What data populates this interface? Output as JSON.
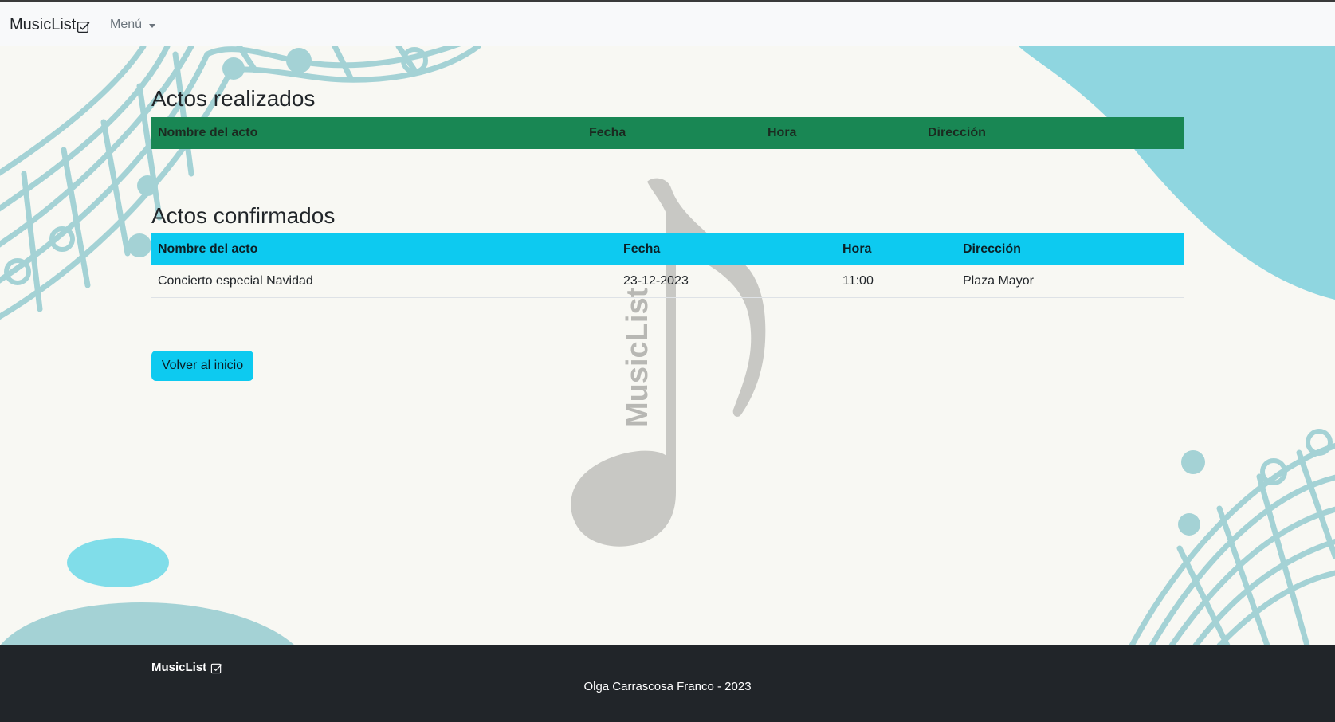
{
  "navbar": {
    "brand": "MusicList",
    "brand_icon": "check-square-icon",
    "menu_label": "Menú"
  },
  "watermark": {
    "text": "MusicList"
  },
  "sections": {
    "realizados": {
      "title": "Actos realizados",
      "columns": [
        "Nombre del acto",
        "Fecha",
        "Hora",
        "Dirección"
      ],
      "rows": []
    },
    "confirmados": {
      "title": "Actos confirmados",
      "columns": [
        "Nombre del acto",
        "Fecha",
        "Hora",
        "Dirección"
      ],
      "rows": [
        [
          "Concierto especial Navidad",
          "23-12-2023",
          "11:00",
          "Plaza Mayor"
        ]
      ]
    }
  },
  "buttons": {
    "home": "Volver al inicio"
  },
  "footer": {
    "brand": "MusicList",
    "brand_icon": "check-square-icon",
    "copyright": "Olga Carrascosa Franco - 2023"
  },
  "colors": {
    "navbar_bg": "#f8f9fa",
    "page_bg": "#f8f8f3",
    "table_realizados_header": "#198754",
    "table_confirmados_header": "#0dcaf0",
    "button_bg": "#0dcaf0",
    "footer_bg": "#212529",
    "decor_teal": "#a4d2d5",
    "decor_cyan": "#80dde9",
    "note_gray": "#c8c8c4"
  }
}
